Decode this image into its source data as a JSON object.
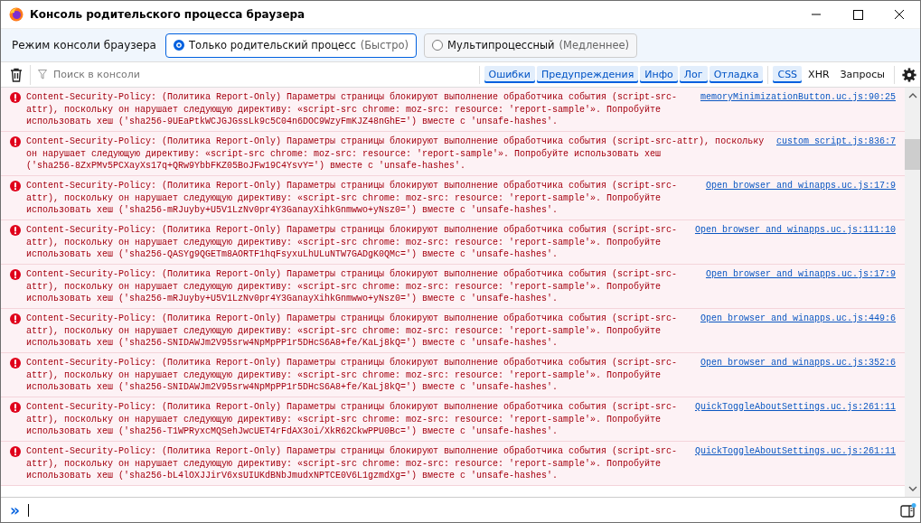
{
  "window": {
    "title": "Консоль родительского процесса браузера"
  },
  "mode_bar": {
    "label": "Режим консоли браузера",
    "options": [
      {
        "label": "Только родительский процесс",
        "hint": "(Быстро)",
        "selected": true
      },
      {
        "label": "Мультипроцессный",
        "hint": "(Медленнее)",
        "selected": false
      }
    ]
  },
  "toolbar": {
    "search": {
      "placeholder": "Поиск в консоли"
    },
    "level_filters": [
      {
        "label": "Ошибки",
        "selected": true
      },
      {
        "label": "Предупреждения",
        "selected": true
      },
      {
        "label": "Инфо",
        "selected": true
      },
      {
        "label": "Лог",
        "selected": true
      },
      {
        "label": "Отладка",
        "selected": true
      }
    ],
    "type_filters": [
      {
        "label": "CSS",
        "selected": true
      },
      {
        "label": "XHR",
        "selected": false
      },
      {
        "label": "Запросы",
        "selected": false
      }
    ]
  },
  "messages": [
    {
      "kind": "error",
      "lines": [
        "Content-Security-Policy: (Политика Report-Only) Параметры страницы блокируют выполнение обработчика события (script-src-",
        "attr), поскольку он нарушает следующую директиву: «script-src chrome: moz-src: resource: 'report-sample'». Попробуйте",
        "использовать хеш ('sha256-9UEaPtkWCJGJGssLk9c5C04n6DOC9WzyFmKJZ48nGhE=') вместе с 'unsafe-hashes'."
      ],
      "source": "memoryMinimizationButton.uc.js:90:25"
    },
    {
      "kind": "error",
      "lines": [
        "Content-Security-Policy: (Политика Report-Only) Параметры страницы блокируют выполнение обработчика события (script-src-attr), поскольку",
        "он нарушает следующую директиву: «script-src chrome: moz-src: resource: 'report-sample'». Попробуйте использовать хеш",
        "('sha256-8ZxPMv5PCXayXs17q+QRw9YbbFKZ05BoJFw19C4YsvY=') вместе с 'unsafe-hashes'."
      ],
      "source": "custom script.js:836:7"
    },
    {
      "kind": "error",
      "lines": [
        "Content-Security-Policy: (Политика Report-Only) Параметры страницы блокируют выполнение обработчика события (script-src-",
        "attr), поскольку он нарушает следующую директиву: «script-src chrome: moz-src: resource: 'report-sample'». Попробуйте",
        "использовать хеш ('sha256-mRJuyby+U5V1LzNv0pr4Y3GanayXihkGnmwwo+yNsz0=') вместе с 'unsafe-hashes'."
      ],
      "source": "Open browser and winapps.uc.js:17:9"
    },
    {
      "kind": "error",
      "lines": [
        "Content-Security-Policy: (Политика Report-Only) Параметры страницы блокируют выполнение обработчика события (script-src-",
        "attr), поскольку он нарушает следующую директиву: «script-src chrome: moz-src: resource: 'report-sample'». Попробуйте",
        "использовать хеш ('sha256-QASYg9QGETm8AORTF1hqFsyxuLhULuNTW7GADgK0QMc=') вместе с 'unsafe-hashes'."
      ],
      "source": "Open browser and winapps.uc.js:111:10"
    },
    {
      "kind": "error",
      "lines": [
        "Content-Security-Policy: (Политика Report-Only) Параметры страницы блокируют выполнение обработчика события (script-src-",
        "attr), поскольку он нарушает следующую директиву: «script-src chrome: moz-src: resource: 'report-sample'». Попробуйте",
        "использовать хеш ('sha256-mRJuyby+U5V1LzNv0pr4Y3GanayXihkGnmwwo+yNsz0=') вместе с 'unsafe-hashes'."
      ],
      "source": "Open browser and winapps.uc.js:17:9"
    },
    {
      "kind": "error",
      "lines": [
        "Content-Security-Policy: (Политика Report-Only) Параметры страницы блокируют выполнение обработчика события (script-src-",
        "attr), поскольку он нарушает следующую директиву: «script-src chrome: moz-src: resource: 'report-sample'». Попробуйте",
        "использовать хеш ('sha256-SNIDAWJm2V95srw4NpMpPP1r5DHcS6A8+fe/KaLj8kQ=') вместе с 'unsafe-hashes'."
      ],
      "source": "Open browser and winapps.uc.js:449:6"
    },
    {
      "kind": "error",
      "lines": [
        "Content-Security-Policy: (Политика Report-Only) Параметры страницы блокируют выполнение обработчика события (script-src-",
        "attr), поскольку он нарушает следующую директиву: «script-src chrome: moz-src: resource: 'report-sample'». Попробуйте",
        "использовать хеш ('sha256-SNIDAWJm2V95srw4NpMpPP1r5DHcS6A8+fe/KaLj8kQ=') вместе с 'unsafe-hashes'."
      ],
      "source": "Open browser and winapps.uc.js:352:6"
    },
    {
      "kind": "error",
      "lines": [
        "Content-Security-Policy: (Политика Report-Only) Параметры страницы блокируют выполнение обработчика события (script-src-",
        "attr), поскольку он нарушает следующую директиву: «script-src chrome: moz-src: resource: 'report-sample'». Попробуйте",
        "использовать хеш ('sha256-T1WPRyxcMQSehJwcUET4rFdAX3oi/XkR62CkwPPU0Bc=') вместе с 'unsafe-hashes'."
      ],
      "source": "QuickToggleAboutSettings.uc.js:261:11"
    },
    {
      "kind": "error",
      "lines": [
        "Content-Security-Policy: (Политика Report-Only) Параметры страницы блокируют выполнение обработчика события (script-src-",
        "attr), поскольку он нарушает следующую директиву: «script-src chrome: moz-src: resource: 'report-sample'». Попробуйте",
        "использовать хеш ('sha256-bL4lOXJJirV6xsUIUKdBNbJmudxNPTCE0V6L1gzmdXg=') вместе с 'unsafe-hashes'."
      ],
      "source": "QuickToggleAboutSettings.uc.js:261:11"
    }
  ],
  "input": {
    "prompt": "»"
  }
}
